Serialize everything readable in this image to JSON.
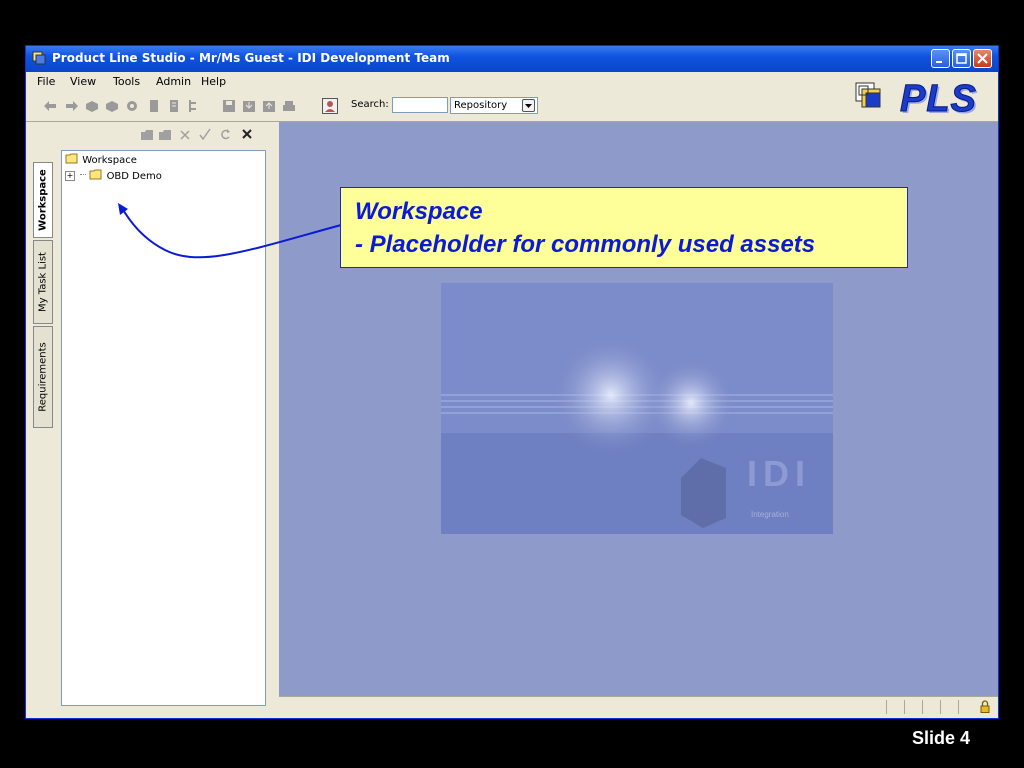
{
  "window": {
    "title": "Product Line Studio - Mr/Ms Guest - IDI Development Team",
    "controls": [
      "minimize",
      "maximize",
      "close"
    ]
  },
  "menubar": {
    "items": [
      "File",
      "View",
      "Tools",
      "Admin",
      "Help"
    ]
  },
  "toolbar": {
    "icons": [
      "back-arrow-icon",
      "forward-arrow-icon",
      "cube-icon",
      "cube-icon",
      "gear-icon",
      "document-icon",
      "document-icon",
      "tree-icon",
      "save-icon",
      "import-icon",
      "export-icon",
      "print-icon",
      "user-icon"
    ],
    "search_label": "Search:",
    "search_value": "",
    "scope_select": "Repository"
  },
  "logo": {
    "text": "PLS"
  },
  "side_tabs": [
    {
      "label": "Workspace",
      "active": true
    },
    {
      "label": "My Task List",
      "active": false
    },
    {
      "label": "Requirements",
      "active": false
    }
  ],
  "workspace_panel": {
    "tool_icons": [
      "new-folder-icon",
      "folder-icon",
      "delete-icon",
      "check-icon",
      "refresh-icon",
      "close-icon"
    ],
    "tree": {
      "root": "Workspace",
      "children": [
        {
          "label": "OBD Demo",
          "expand_symbol": "+"
        }
      ]
    }
  },
  "splash": {
    "brand": "IDI",
    "tagline": "Integration"
  },
  "callout": {
    "line1": "Workspace",
    "line2": "- Placeholder for commonly used assets"
  },
  "slide": {
    "label": "Slide 4"
  },
  "colors": {
    "titlebar": "#0a46c8",
    "content_bg": "#8e9ac9",
    "callout_bg": "#ffff99",
    "callout_text": "#0a1ad6"
  }
}
